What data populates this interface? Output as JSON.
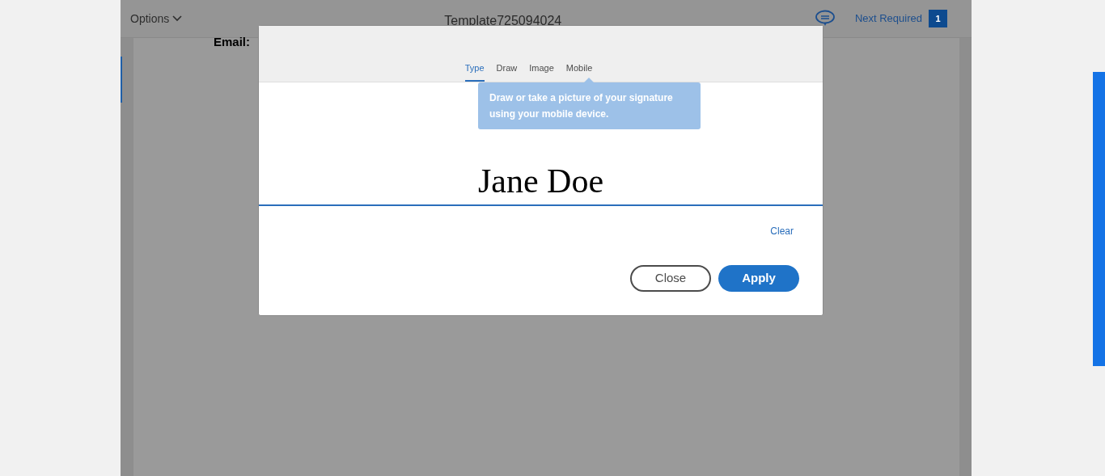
{
  "toolbar": {
    "options_menu": "Options",
    "document_title": "Template725094024",
    "next_required": {
      "label": "Next Required",
      "count": "1"
    }
  },
  "document": {
    "field_label": "Email:"
  },
  "signature_dialog": {
    "tabs": [
      {
        "label": "Type",
        "selected": true
      },
      {
        "label": "Draw",
        "selected": false
      },
      {
        "label": "Image",
        "selected": false
      },
      {
        "label": "Mobile",
        "selected": false
      }
    ],
    "tooltip": "Draw or take a picture of your signature using your mobile device.",
    "signature": "Jane Doe",
    "clear": "Clear",
    "buttons": [
      {
        "label": "Close",
        "kind": "secondary"
      },
      {
        "label": "Apply",
        "kind": "primary"
      }
    ]
  }
}
